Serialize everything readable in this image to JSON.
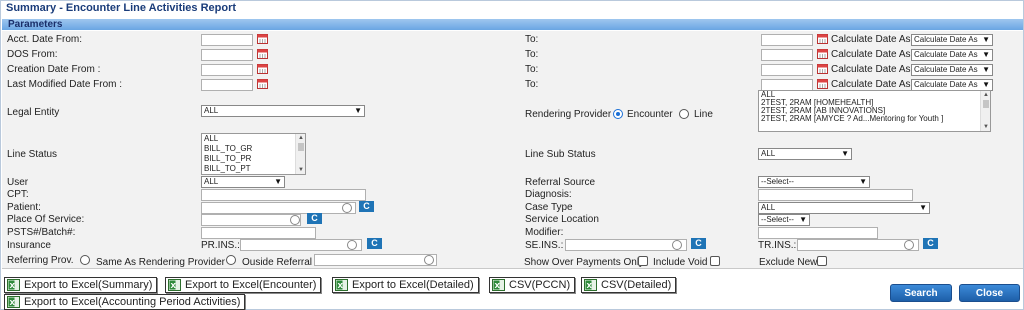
{
  "title": "Summary - Encounter Line Activities Report",
  "section": "Parameters",
  "dates": [
    {
      "from_label": "Acct. Date From:",
      "to_label": "To:",
      "calc_label": "Calculate Date As",
      "calc_select": "Calculate Date As"
    },
    {
      "from_label": "DOS From:",
      "to_label": "To:",
      "calc_label": "Calculate Date As",
      "calc_select": "Calculate Date As"
    },
    {
      "from_label": "Creation Date From :",
      "to_label": "To:",
      "calc_label": "Calculate Date As",
      "calc_select": "Calculate Date As"
    },
    {
      "from_label": "Last Modified Date From :",
      "to_label": "To:",
      "calc_label": "Calculate Date As",
      "calc_select": "Calculate Date As"
    }
  ],
  "legal_entity": {
    "label": "Legal Entity",
    "value": "ALL"
  },
  "rendering_provider": {
    "label": "Rendering Provider",
    "radio_encounter": "Encounter",
    "radio_line": "Line",
    "options": [
      "ALL",
      "2TEST, 2RAM [HOMEHEALTH]",
      "2TEST, 2RAM [AB INNOVATIONS]",
      "2TEST, 2RAM [AMYCE ? Ad...Mentoring for Youth ]"
    ]
  },
  "line_status": {
    "label": "Line Status",
    "options": [
      "ALL",
      "BILL_TO_GR",
      "BILL_TO_PR",
      "BILL_TO_PT"
    ]
  },
  "line_sub_status": {
    "label": "Line Sub Status",
    "value": "ALL"
  },
  "user": {
    "label": "User",
    "value": "ALL"
  },
  "referral_source": {
    "label": "Referral Source",
    "value": "--Select--"
  },
  "cpt": {
    "label": "CPT:"
  },
  "diagnosis": {
    "label": "Diagnosis:"
  },
  "patient": {
    "label": "Patient:",
    "c": "C"
  },
  "case_type": {
    "label": "Case Type",
    "value": "ALL"
  },
  "place_of_service": {
    "label": "Place Of Service:",
    "c": "C"
  },
  "service_location": {
    "label": "Service Location",
    "value": "--Select--"
  },
  "psts": {
    "label": "PSTS#/Batch#:"
  },
  "modifier": {
    "label": "Modifier:"
  },
  "insurance": {
    "label": "Insurance",
    "pr": "PR.INS.:",
    "se": "SE.INS.:",
    "tr": "TR.INS.:",
    "c": "C"
  },
  "referring": {
    "label": "Referring Prov.",
    "same": "Same As Rendering Provider",
    "outside": "Ouside Referral"
  },
  "show_over": "Show Over Payments Only",
  "include_void": "Include Void",
  "exclude_new": "Exclude New",
  "exports": [
    "Export to Excel(Summary)",
    "Export to Excel(Encounter)",
    "Export to Excel(Detailed)",
    "CSV(PCCN)",
    "CSV(Detailed)",
    "Export to Excel(Accounting Period Activities)"
  ],
  "search_label": "Search",
  "close_label": "Close",
  "colors": {
    "accent": "#1f74b6",
    "header": "#6aa5e3",
    "title": "#1a3c7a"
  },
  "icons": [
    "calendar-icon",
    "search-icon",
    "excel-icon"
  ]
}
